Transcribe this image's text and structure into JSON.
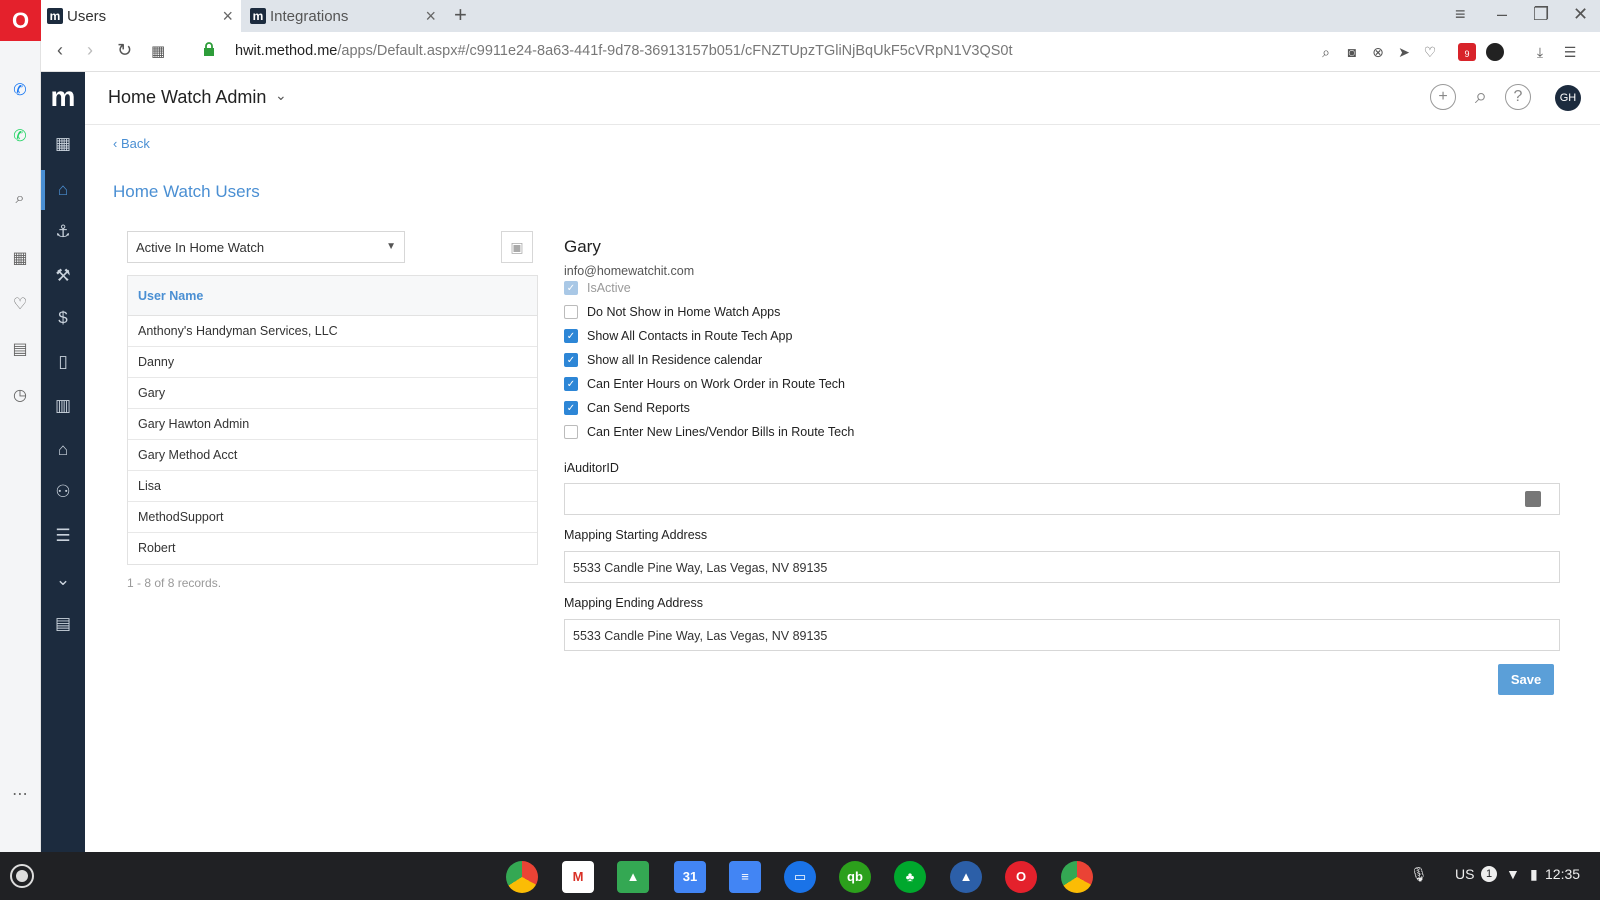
{
  "browser": {
    "tabs": [
      {
        "label": "Users",
        "favicon": "m"
      },
      {
        "label": "Integrations",
        "favicon": "m"
      }
    ],
    "url_host": "hwit.method.me",
    "url_rest": "/apps/Default.aspx#/c9911e24-8a63-441f-9d78-36913157b051/cFNZTUpzTGliNjBqUkF5cVRpN1V3QS0t",
    "badge_count": "9"
  },
  "app": {
    "logo": "m",
    "title": "Home Watch Admin",
    "avatar_initials": "GH",
    "accent_color": "#4a8fd3",
    "sidebar_bg": "#1c2b3e"
  },
  "page": {
    "back_label": "Back",
    "title": "Home Watch Users",
    "filter_value": "Active In Home Watch",
    "grid_header": "User Name",
    "users": [
      "Anthony's Handyman Services, LLC",
      "Danny",
      "Gary",
      "Gary Hawton Admin",
      "Gary Method Acct",
      "Lisa",
      "MethodSupport",
      "Robert"
    ],
    "records_label": "1 - 8 of 8 records."
  },
  "detail": {
    "name": "Gary",
    "email": "info@homewatchit.com",
    "options": [
      {
        "label": "IsActive",
        "checked": true,
        "disabled": true
      },
      {
        "label": "Do Not Show in Home Watch Apps",
        "checked": false,
        "disabled": false
      },
      {
        "label": "Show All Contacts in Route Tech App",
        "checked": true,
        "disabled": false
      },
      {
        "label": "Show all In Residence calendar",
        "checked": true,
        "disabled": false
      },
      {
        "label": "Can Enter Hours on Work Order in Route Tech",
        "checked": true,
        "disabled": false
      },
      {
        "label": "Can Send Reports",
        "checked": true,
        "disabled": false
      },
      {
        "label": "Can Enter New Lines/Vendor Bills in Route Tech",
        "checked": false,
        "disabled": false
      }
    ],
    "iauditor_label": "iAuditorID",
    "iauditor_value": "",
    "start_label": "Mapping Starting Address",
    "start_value": "5533 Candle Pine Way, Las Vegas, NV 89135",
    "end_label": "Mapping Ending Address",
    "end_value": "5533 Candle Pine Way, Las Vegas, NV 89135",
    "save_label": "Save"
  },
  "taskbar": {
    "calendar_day": "31",
    "locale": "US",
    "notification_count": "1",
    "time": "12:35"
  }
}
